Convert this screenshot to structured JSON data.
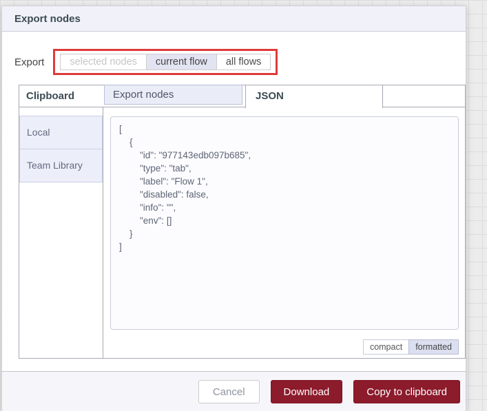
{
  "dialog": {
    "title": "Export nodes",
    "export_label": "Export",
    "export_options": [
      {
        "label": "selected nodes",
        "state": "disabled"
      },
      {
        "label": "current flow",
        "state": "selected"
      },
      {
        "label": "all flows",
        "state": "normal"
      }
    ],
    "tabs": {
      "clipboard": "Clipboard",
      "export_nodes": "Export nodes",
      "json": "JSON"
    },
    "sidebar": {
      "items": [
        {
          "label": "Local"
        },
        {
          "label": "Team Library"
        }
      ]
    },
    "json_content": "[\n    {\n        \"id\": \"977143edb097b685\",\n        \"type\": \"tab\",\n        \"label\": \"Flow 1\",\n        \"disabled\": false,\n        \"info\": \"\",\n        \"env\": []\n    }\n]",
    "format_toggle": {
      "compact": "compact",
      "formatted": "formatted",
      "selected": "formatted"
    },
    "footer": {
      "cancel": "Cancel",
      "download": "Download",
      "copy": "Copy to clipboard"
    }
  },
  "colors": {
    "primary_button": "#8c1b2c",
    "annotation_highlight": "#e03a3a",
    "selected_tab_bg": "#eaecf8",
    "header_bg": "#f1f1f9",
    "title_text": "#3c4b54"
  }
}
